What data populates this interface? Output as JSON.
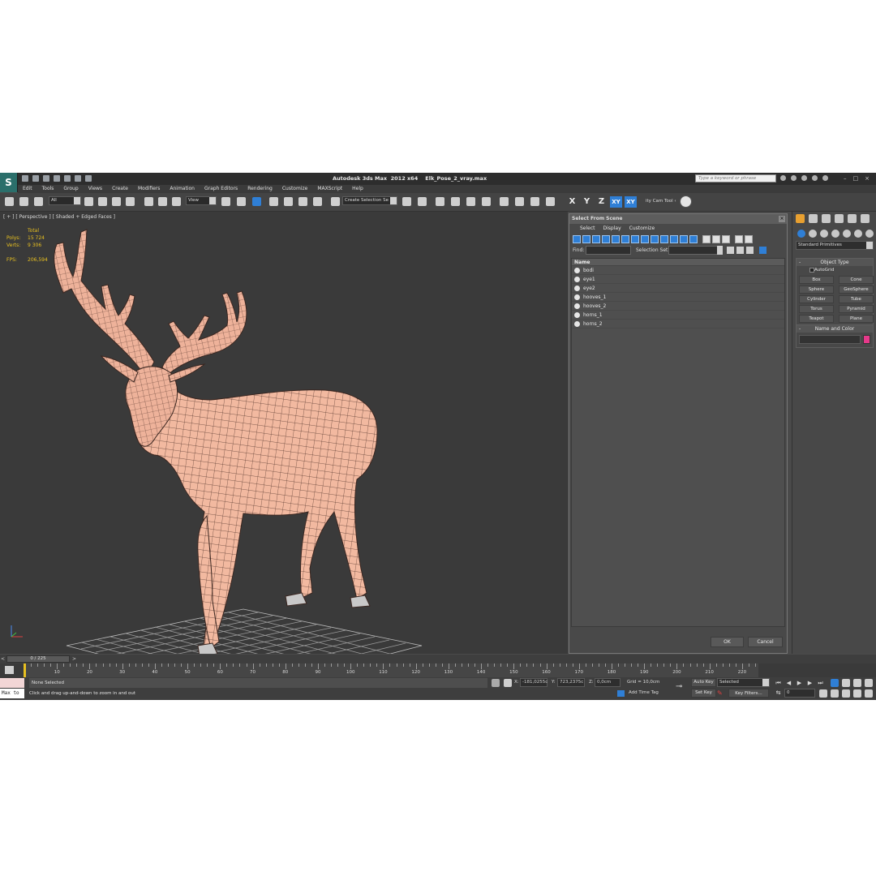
{
  "app": {
    "logo_text": "S",
    "title": "Autodesk 3ds Max  2012 x64    Elk_Pose_2_vray.max",
    "search_placeholder": "Type a keyword or phrase"
  },
  "menu": [
    "Edit",
    "Tools",
    "Group",
    "Views",
    "Create",
    "Modifiers",
    "Animation",
    "Graph Editors",
    "Rendering",
    "Customize",
    "MAXScript",
    "Help"
  ],
  "toolbar": {
    "filter_value": "All",
    "refcoord_value": "View",
    "selection_set_value": "Create Selection Se",
    "axis_x": "X",
    "axis_y": "Y",
    "axis_z": "Z",
    "axis_xy": "XY",
    "axis_xy2": "XY",
    "cam_tool": "ity Cam Tool ‹"
  },
  "viewport": {
    "label": "[ + ] [ Perspective ] [ Shaded + Edged Faces ]",
    "stats_header": "Total",
    "polys_label": "Polys:",
    "polys_value": "15 724",
    "verts_label": "Verts:",
    "verts_value": "9 306",
    "fps_label": "FPS:",
    "fps_value": "206,594"
  },
  "dialog": {
    "title": "Select From Scene",
    "menu": [
      "Select",
      "Display",
      "Customize"
    ],
    "find_label": "Find:",
    "selset_label": "Selection Set:",
    "column_name": "Name",
    "items": [
      "bodi",
      "eye1",
      "eye2",
      "hooves_1",
      "hooves_2",
      "horns_1",
      "horns_2"
    ],
    "ok_label": "OK",
    "cancel_label": "Cancel"
  },
  "command_panel": {
    "category": "Standard Primitives",
    "object_type_header": "Object Type",
    "autogrid_label": "AutoGrid",
    "objects": [
      "Box",
      "Cone",
      "Sphere",
      "GeoSphere",
      "Cylinder",
      "Tube",
      "Torus",
      "Pyramid",
      "Teapot",
      "Plane"
    ],
    "name_color_header": "Name and Color",
    "swatch_color": "#e6398a"
  },
  "timeline": {
    "slider_label": "0 / 225",
    "frame_current": 0,
    "frame_total": 225,
    "ticks": [
      "10",
      "20",
      "30",
      "40",
      "50",
      "60",
      "70",
      "80",
      "90",
      "100",
      "110",
      "120",
      "130",
      "140",
      "150",
      "160",
      "170",
      "180",
      "190",
      "200",
      "210",
      "220"
    ]
  },
  "status": {
    "maxscript_text": "Max to",
    "selection_text": "None Selected",
    "prompt_text": "Click and drag up-and-down to zoom in and out",
    "x_label": "X:",
    "x_value": "-181,0255c",
    "y_label": "Y:",
    "y_value": "723,2375c",
    "z_label": "Z:",
    "z_value": "0,0cm",
    "grid_text": "Grid = 10,0cm",
    "add_time_tag": "Add Time Tag",
    "auto_key": "Auto Key",
    "key_mode": "Selected",
    "set_key": "Set Key",
    "key_filters": "Key Filters...",
    "current_frame": "0"
  }
}
